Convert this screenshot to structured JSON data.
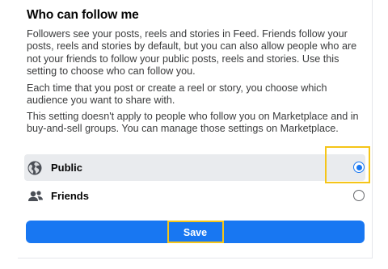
{
  "section": {
    "title": "Who can follow me",
    "paragraphs": [
      "Followers see your posts, reels and stories in Feed. Friends follow your posts, reels and stories by default, but you can also allow people who are not your friends to follow your public posts, reels and stories. Use this setting to choose who can follow you.",
      "Each time that you post or create a reel or story, you choose which audience you want to share with.",
      "This setting doesn't apply to people who follow you on Marketplace and in buy-and-sell groups. You can manage those settings on Marketplace."
    ]
  },
  "options": [
    {
      "label": "Public",
      "icon": "globe-icon",
      "selected": true
    },
    {
      "label": "Friends",
      "icon": "friends-icon",
      "selected": false
    }
  ],
  "save_button": {
    "label": "Save"
  },
  "colors": {
    "accent": "#1877f2",
    "highlight": "#f5c518",
    "selected_row": "#e9ebee"
  }
}
